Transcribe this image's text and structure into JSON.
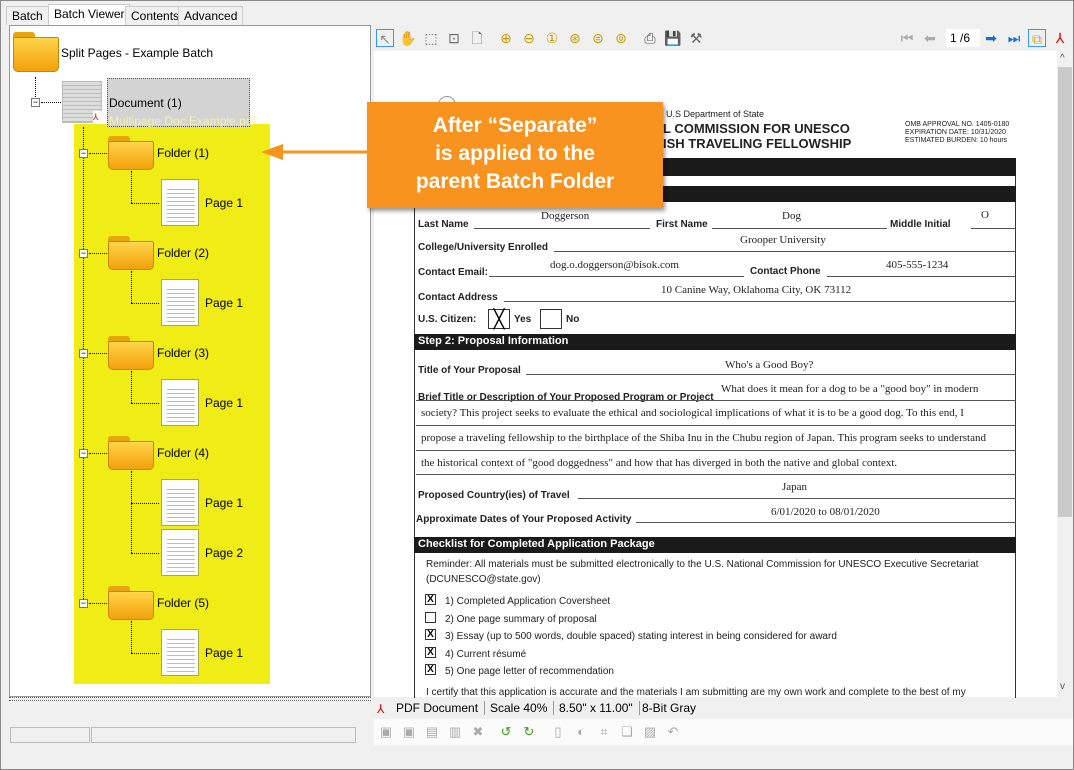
{
  "tabs": [
    "Batch",
    "Batch Viewer",
    "Contents",
    "Advanced"
  ],
  "tree": {
    "root": "Split Pages - Example Batch",
    "document": "Document (1)",
    "document_file": "Multipage Doc Example.pdf",
    "folders": [
      {
        "label": "Folder (1)",
        "pages": [
          "Page 1"
        ]
      },
      {
        "label": "Folder (2)",
        "pages": [
          "Page 1"
        ]
      },
      {
        "label": "Folder (3)",
        "pages": [
          "Page 1"
        ]
      },
      {
        "label": "Folder (4)",
        "pages": [
          "Page 1",
          "Page 2"
        ]
      },
      {
        "label": "Folder (5)",
        "pages": [
          "Page 1"
        ]
      }
    ]
  },
  "callout": {
    "line1": "After “Separate”",
    "line2": "is applied to the",
    "line3": "parent Batch Folder"
  },
  "toolbar": {
    "page_current": "1",
    "page_total": "/6"
  },
  "document": {
    "dept": "U.S Department of State",
    "title1": "L COMMISSION FOR UNESCO",
    "title2": "ISH TRAVELING FELLOWSHIP",
    "omb": "OMB APPROVAL NO. 1405-0180",
    "exp": "EXPIRATION DATE:  10/31/2020",
    "burden": "ESTIMATED BURDEN: 10 hours",
    "last_name_label": "Last Name",
    "last_name": "Doggerson",
    "first_name_label": "First Name",
    "first_name": "Dog",
    "mi_label": "Middle Initial",
    "mi": "O",
    "college_label": "College/University Enrolled",
    "college": "Grooper University",
    "email_label": "Contact Email:",
    "email": "dog.o.doggerson@bisok.com",
    "phone_label": "Contact Phone",
    "phone": "405-555-1234",
    "address_label": "Contact Address",
    "address": "10 Canine Way, Oklahoma City, OK 73112",
    "citizen_label": "U.S. Citizen:",
    "yes": "Yes",
    "no": "No",
    "step2": "Step 2: Proposal Information",
    "proposal_title_label": "Title of Your Proposal",
    "proposal_title": "Who's a Good Boy?",
    "brief_label": "Brief Title or Description of Your Proposed Program or Project",
    "brief": [
      "What does it mean for a dog to be a \"good boy\" in modern",
      "society?  This project seeks to evaluate the ethical and sociological implications of what it is to be a good dog.  To this end, I",
      "propose a traveling fellowship to the birthplace of the Shiba Inu in the Chubu region of Japan.  This program seeks to understand",
      "the historical context of \"good doggedness\" and how that has diverged in both the native and global context."
    ],
    "country_label": "Proposed Country(ies) of Travel",
    "country": "Japan",
    "dates_label": "Approximate Dates of Your Proposed Activity",
    "dates": "6/01/2020 to 08/01/2020",
    "checklist_title": "Checklist for Completed Application Package",
    "reminder1": "Reminder: All materials must be submitted electronically to the U.S. National Commission for UNESCO Executive Secretariat",
    "reminder2": "(DCUNESCO@state.gov)",
    "checklist": [
      {
        "text": "1) Completed Application Coversheet",
        "checked": true
      },
      {
        "text": "2) One page summary of proposal",
        "checked": false
      },
      {
        "text": "3) Essay (up to 500 words, double spaced) stating interest in being considered for award",
        "checked": true
      },
      {
        "text": "4) Current résumé",
        "checked": true
      },
      {
        "text": "5) One page letter of recommendation",
        "checked": true
      }
    ],
    "certify": "I certify that this application is accurate and the materials I am submitting are my own work and complete to the best of my"
  },
  "status": {
    "type": "PDF Document",
    "scale": "Scale 40%",
    "size": "8.50\" x 11.00\"",
    "color": "8-Bit Gray"
  }
}
